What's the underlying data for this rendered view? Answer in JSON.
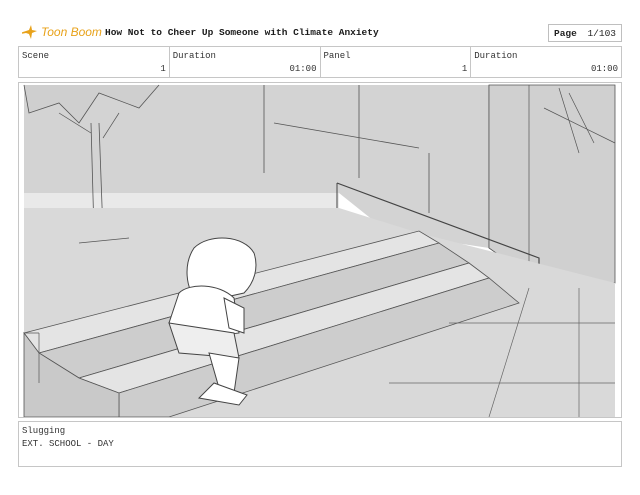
{
  "header": {
    "brand": "Toon Boom",
    "doc_title": "How Not to Cheer Up Someone with Climate Anxiety",
    "page_label": "Page",
    "page_value": "1/103"
  },
  "info": {
    "scene_label": "Scene",
    "scene_value": "1",
    "duration1_label": "Duration",
    "duration1_value": "01:00",
    "panel_label": "Panel",
    "panel_value": "1",
    "duration2_label": "Duration",
    "duration2_value": "01:00"
  },
  "slugging": {
    "label": "Slugging",
    "text": "EXT. SCHOOL - DAY"
  },
  "colors": {
    "brand_orange": "#e8a21a",
    "sketch_fill": "#d4d4d4",
    "sketch_line": "#4a4a4a"
  }
}
